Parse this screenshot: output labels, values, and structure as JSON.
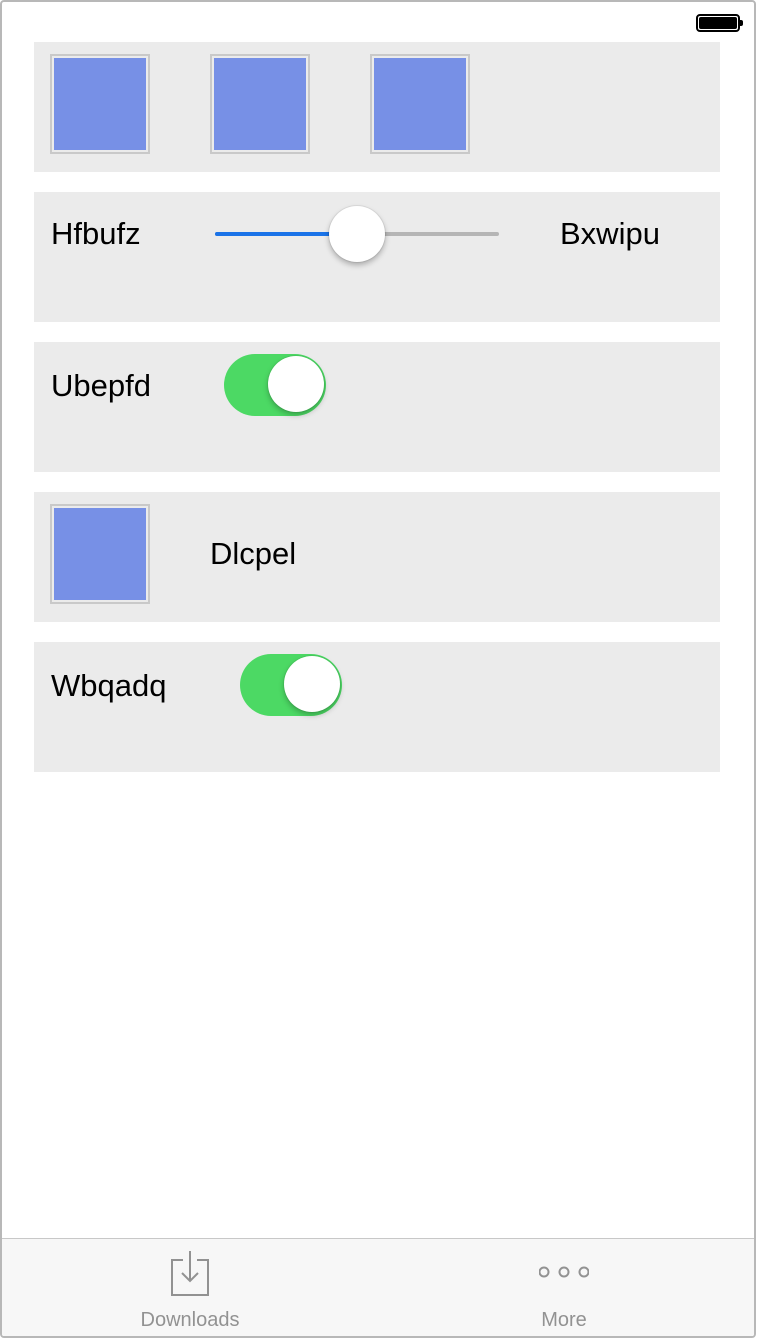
{
  "colors": {
    "card_background": "#ebebeb",
    "swatch_fill": "#7790e6",
    "slider_active": "#1a73e8",
    "slider_inactive": "#b5b5b5",
    "toggle_on": "#4cd964",
    "tab_inactive": "#929292"
  },
  "cards": {
    "swatches": {
      "count": 3
    },
    "slider": {
      "min_label": "Hfbufz",
      "max_label": "Bxwipu",
      "value_fraction": 0.5
    },
    "toggle1": {
      "label": "Ubepfd",
      "on": true
    },
    "image_row": {
      "label": "Dlcpel"
    },
    "toggle2": {
      "label": "Wbqadq",
      "on": true
    }
  },
  "tab_bar": {
    "tabs": [
      {
        "label": "Downloads",
        "icon": "downloads-icon"
      },
      {
        "label": "More",
        "icon": "more-icon"
      }
    ]
  }
}
